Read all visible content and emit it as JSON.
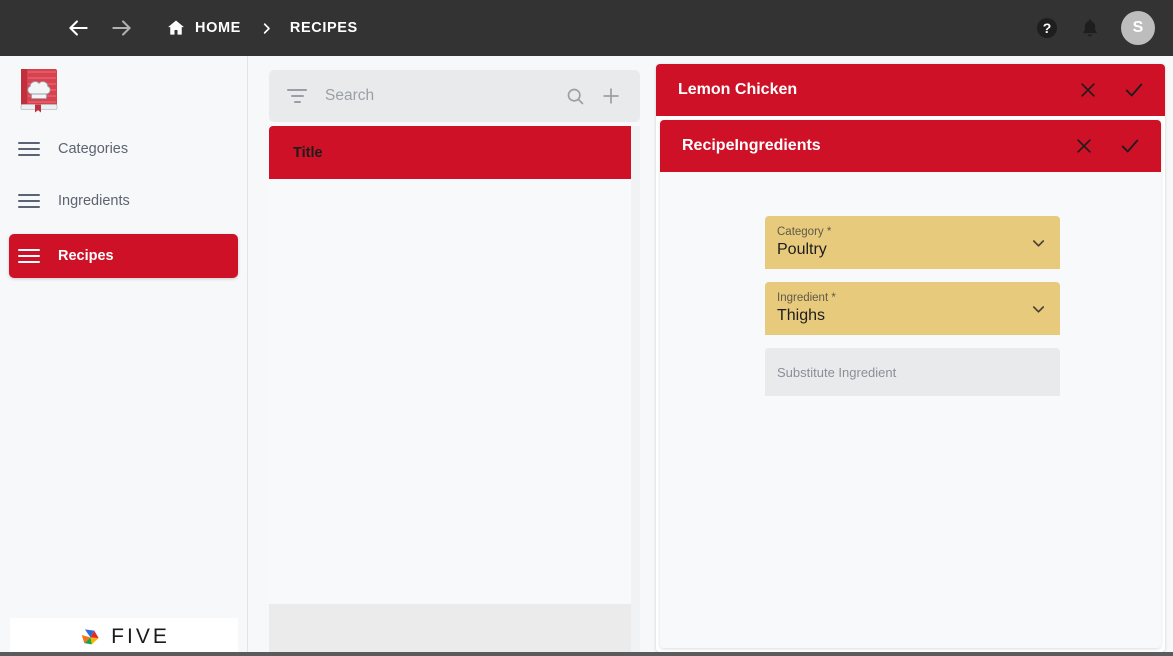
{
  "topbar": {
    "menu_icon": "hamburger-icon",
    "back_icon": "arrow-left-icon",
    "forward_icon": "arrow-right-icon",
    "home_icon": "home-icon",
    "home_label": "HOME",
    "separator": "chevron-right-icon",
    "current_label": "RECIPES",
    "help_icon": "help-circle-icon",
    "bell_icon": "bell-icon",
    "avatar_initial": "S",
    "background": "#333333"
  },
  "sidebar": {
    "logo_icon": "cookbook-icon",
    "items": [
      {
        "label": "Categories",
        "icon": "menu-icon",
        "active": false
      },
      {
        "label": "Ingredients",
        "icon": "menu-icon",
        "active": false
      },
      {
        "label": "Recipes",
        "icon": "menu-icon",
        "active": true
      }
    ],
    "footer_brand": "FIVE",
    "footer_logo_icon": "five-pinwheel-icon",
    "active_color": "#ce1127"
  },
  "list_panel": {
    "search": {
      "filter_icon": "filter-icon",
      "placeholder": "Search",
      "value": "",
      "search_icon": "search-icon",
      "add_icon": "plus-icon"
    },
    "grid": {
      "columns": [
        "Title"
      ],
      "rows": [],
      "header_color": "#ce1127"
    }
  },
  "detail_panel": {
    "outer_card": {
      "title": "Lemon Chicken",
      "close_icon": "close-icon",
      "confirm_icon": "check-icon",
      "header_color": "#ce1127"
    },
    "inner_card": {
      "title": "RecipeIngredients",
      "close_icon": "close-icon",
      "confirm_icon": "check-icon",
      "header_color": "#ce1127"
    },
    "fields": [
      {
        "name": "category",
        "label": "Category *",
        "value": "Poultry",
        "required": true,
        "dropdown": true,
        "dropdown_icon": "chevron-down-icon",
        "background": "#e8ca7d"
      },
      {
        "name": "ingredient",
        "label": "Ingredient *",
        "value": "Thighs",
        "required": true,
        "dropdown": true,
        "dropdown_icon": "chevron-down-icon",
        "background": "#e8ca7d"
      },
      {
        "name": "substitute_ingredient",
        "label": "Substitute Ingredient",
        "value": "",
        "required": false,
        "dropdown": false,
        "background": "#e9eaec"
      }
    ],
    "annotation": {
      "icon": "red-arrow-annotation",
      "color": "#e8191f"
    }
  }
}
